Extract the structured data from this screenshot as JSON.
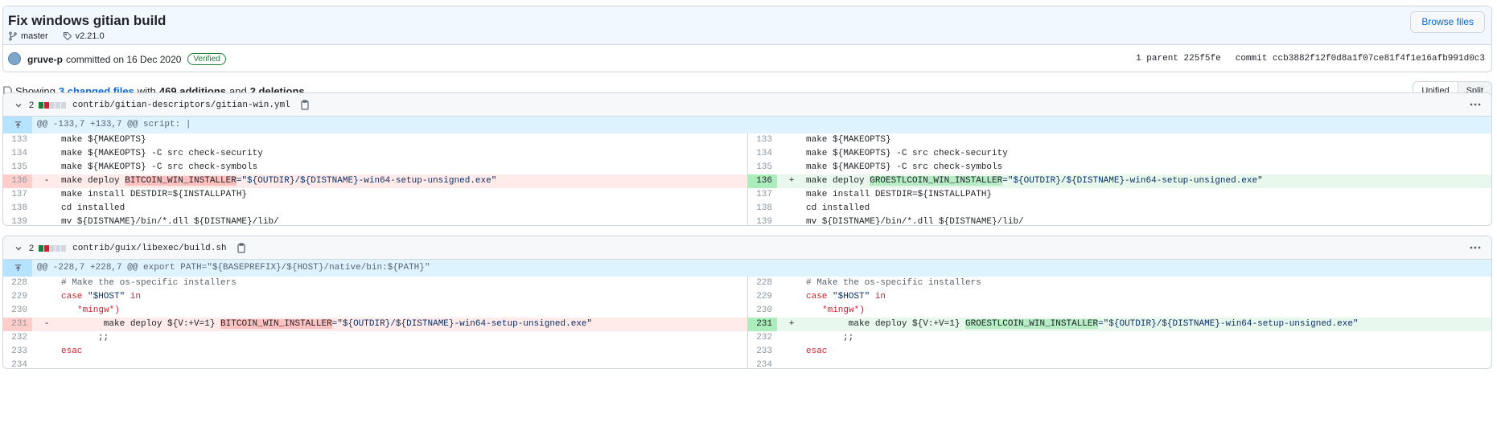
{
  "commit": {
    "title": "Fix windows gitian build",
    "branch": "master",
    "tag": "v2.21.0",
    "browse_files": "Browse files",
    "author": "gruve-p",
    "committed_on": "committed on 16 Dec 2020",
    "verified": "Verified",
    "parent_label": "1 parent",
    "parent_sha": "225f5fe",
    "commit_label": "commit",
    "commit_sha": "ccb3882f12f0d8a1f07ce81f4f1e16afb991d0c3"
  },
  "summary": {
    "showing": "Showing",
    "changed_files": "3 changed files",
    "with": "with",
    "additions": "469 additions",
    "and": "and",
    "deletions": "2 deletions."
  },
  "view_toggle": {
    "unified": "Unified",
    "split": "Split"
  },
  "files": [
    {
      "changes": "2",
      "path": "contrib/gitian-descriptors/gitian-win.yml",
      "hunk": "@@ -133,7 +133,7 @@ script: |",
      "lines": [
        {
          "left_ln": "133",
          "right_ln": "133",
          "text": "make ${MAKEOPTS}"
        },
        {
          "left_ln": "134",
          "right_ln": "134",
          "text": "make ${MAKEOPTS} -C src check-security"
        },
        {
          "left_ln": "135",
          "right_ln": "135",
          "text": "make ${MAKEOPTS} -C src check-symbols"
        },
        {
          "left_ln": "136",
          "right_ln": "136",
          "sign_del": "-",
          "sign_add": "+",
          "del_pre": "make deploy ",
          "del_hl": "BITCOIN_WIN_INSTALLER",
          "del_post": "=\"${OUTDIR}/${DISTNAME}-win64-setup-unsigned.exe\"",
          "add_pre": "make deploy ",
          "add_hl": "GROESTLCOIN_WIN_INSTALLER",
          "add_post": "=\"${OUTDIR}/${DISTNAME}-win64-setup-unsigned.exe\""
        },
        {
          "left_ln": "137",
          "right_ln": "137",
          "text": "make install DESTDIR=${INSTALLPATH}"
        },
        {
          "left_ln": "138",
          "right_ln": "138",
          "text": "cd installed"
        },
        {
          "left_ln": "139",
          "right_ln": "139",
          "text": "mv ${DISTNAME}/bin/*.dll ${DISTNAME}/lib/"
        }
      ]
    },
    {
      "changes": "2",
      "path": "contrib/guix/libexec/build.sh",
      "hunk": "@@ -228,7 +228,7 @@ export PATH=\"${BASEPREFIX}/${HOST}/native/bin:${PATH}\"",
      "lines": [
        {
          "left_ln": "228",
          "right_ln": "228",
          "text": "# Make the os-specific installers"
        },
        {
          "left_ln": "229",
          "right_ln": "229",
          "kw": "case",
          "text": " \"$HOST\" ",
          "kw2": "in"
        },
        {
          "left_ln": "230",
          "right_ln": "230",
          "text": "*mingw*)"
        },
        {
          "left_ln": "231",
          "right_ln": "231",
          "sign_del": "-",
          "sign_add": "+",
          "del_pre": "        make deploy ${V:+V=1} ",
          "del_hl": "BITCOIN_WIN_INSTALLER",
          "del_post": "=\"${OUTDIR}/${DISTNAME}-win64-setup-unsigned.exe\"",
          "add_pre": "        make deploy ${V:+V=1} ",
          "add_hl": "GROESTLCOIN_WIN_INSTALLER",
          "add_post": "=\"${OUTDIR}/${DISTNAME}-win64-setup-unsigned.exe\""
        },
        {
          "left_ln": "232",
          "right_ln": "232",
          "text": ";;"
        },
        {
          "left_ln": "233",
          "right_ln": "233",
          "kw": "esac"
        },
        {
          "left_ln": "234",
          "right_ln": "234",
          "text": ""
        }
      ]
    }
  ]
}
